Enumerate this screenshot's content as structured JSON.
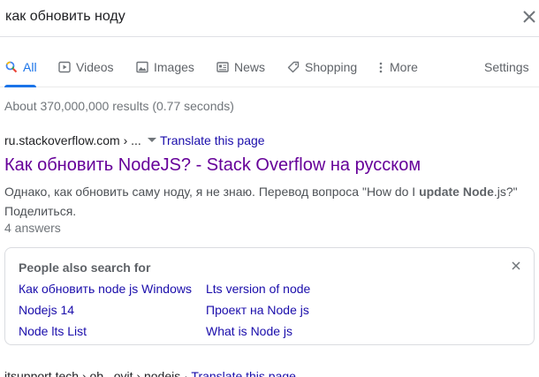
{
  "search": {
    "query": "как обновить ноду"
  },
  "tabs": [
    {
      "label": "All",
      "icon": "search-icon",
      "active": true
    },
    {
      "label": "Videos",
      "icon": "video-icon"
    },
    {
      "label": "Images",
      "icon": "image-icon"
    },
    {
      "label": "News",
      "icon": "newspaper-icon"
    },
    {
      "label": "Shopping",
      "icon": "tag-icon"
    },
    {
      "label": "More",
      "icon": "more-vert-icon"
    }
  ],
  "settings_label": "Settings",
  "stats": "About 370,000,000 results (0.77 seconds)",
  "result": {
    "cite": "ru.stackoverflow.com › ...",
    "translate": "Translate this page",
    "title": "Как обновить NodeJS? - Stack Overflow на русском",
    "snippet_before": "Однако, как обновить саму ноду, я не знаю. Перевод вопроса \"How do I ",
    "snippet_bold1": "update",
    "snippet_space": " ",
    "snippet_bold2": "Node",
    "snippet_after": ".js?\" Поделиться.",
    "answers": "4 answers"
  },
  "people_also_search": {
    "heading": "People also search for",
    "links": [
      "Как обновить node js Windows",
      "Lts version of node",
      "Nodejs 14",
      "Проект на Node js",
      "Node lts List",
      "What is Node js"
    ]
  },
  "next_result": {
    "text": "itsupport.tech › ob...ovit › nodejs · ",
    "translate": "Translate this page"
  },
  "colors": {
    "accent": "#1a73e8",
    "link": "#1a0dab",
    "visited": "#660099"
  }
}
